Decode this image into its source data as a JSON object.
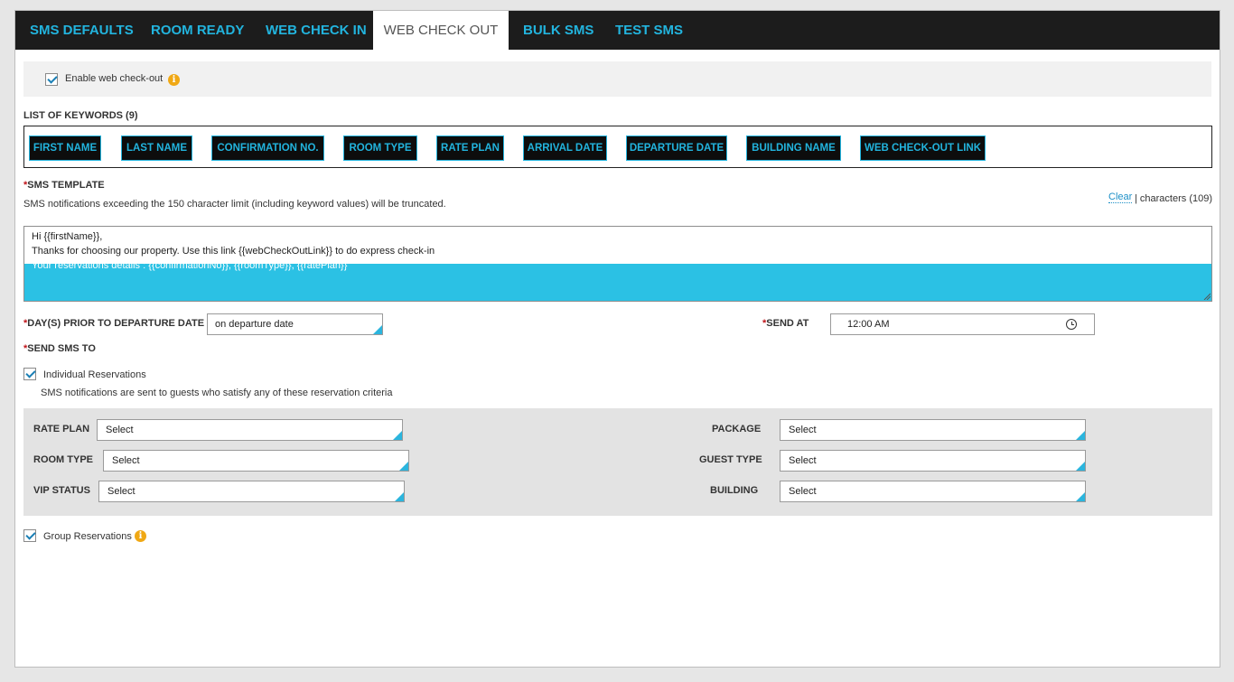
{
  "tabs": [
    {
      "label": "SMS DEFAULTS",
      "active": false
    },
    {
      "label": "ROOM READY",
      "active": false
    },
    {
      "label": "WEB CHECK IN",
      "active": false
    },
    {
      "label": "WEB CHECK OUT",
      "active": true
    },
    {
      "label": "BULK SMS",
      "active": false
    },
    {
      "label": "TEST SMS",
      "active": false
    }
  ],
  "enable": {
    "label": "Enable web check-out",
    "checked": true,
    "info_icon": "info-icon"
  },
  "keywords": {
    "title": "LIST OF KEYWORDS (9)",
    "items": [
      "FIRST NAME",
      "LAST NAME",
      "CONFIRMATION NO.",
      "ROOM TYPE",
      "RATE PLAN",
      "ARRIVAL DATE",
      "DEPARTURE DATE",
      "BUILDING NAME",
      "WEB CHECK-OUT LINK"
    ]
  },
  "template": {
    "title": "SMS TEMPLATE",
    "required_mark": "*",
    "note": "SMS notifications exceeding the 150 character limit (including keyword values) will be truncated.",
    "clear_label": "Clear",
    "count_label": "| characters (109)",
    "lines": [
      "Hi {{firstName}},",
      "Thanks for choosing our property. Use this link {{webCheckOutLink}} to do express check-in",
      "Your reservations details : {{confirmationNo}}, {{roomType}}, {{ratePlan}}"
    ]
  },
  "schedule": {
    "days_label": "DAY(S) PRIOR TO DEPARTURE DATE",
    "days_value": "on departure date",
    "send_at_label": "SEND AT",
    "send_at_value": "12:00 AM"
  },
  "send_to": {
    "title": "SEND SMS TO",
    "individual_label": "Individual Reservations",
    "individual_checked": true,
    "individual_note": "SMS notifications are sent to guests who satisfy any of these reservation criteria",
    "group_label": "Group Reservations",
    "group_checked": true
  },
  "criteria": {
    "rate_plan": {
      "label": "RATE PLAN",
      "value": "Select"
    },
    "room_type": {
      "label": "ROOM TYPE",
      "value": "Select"
    },
    "vip_status": {
      "label": "VIP STATUS",
      "value": "Select"
    },
    "package": {
      "label": "PACKAGE",
      "value": "Select"
    },
    "guest_type": {
      "label": "GUEST TYPE",
      "value": "Select"
    },
    "building": {
      "label": "BUILDING",
      "value": "Select"
    }
  },
  "colors": {
    "accent": "#2bc1e4",
    "tab_text": "#22b4de",
    "tab_bar": "#1c1c1c",
    "required": "#c0141a",
    "info": "#f0a814"
  }
}
